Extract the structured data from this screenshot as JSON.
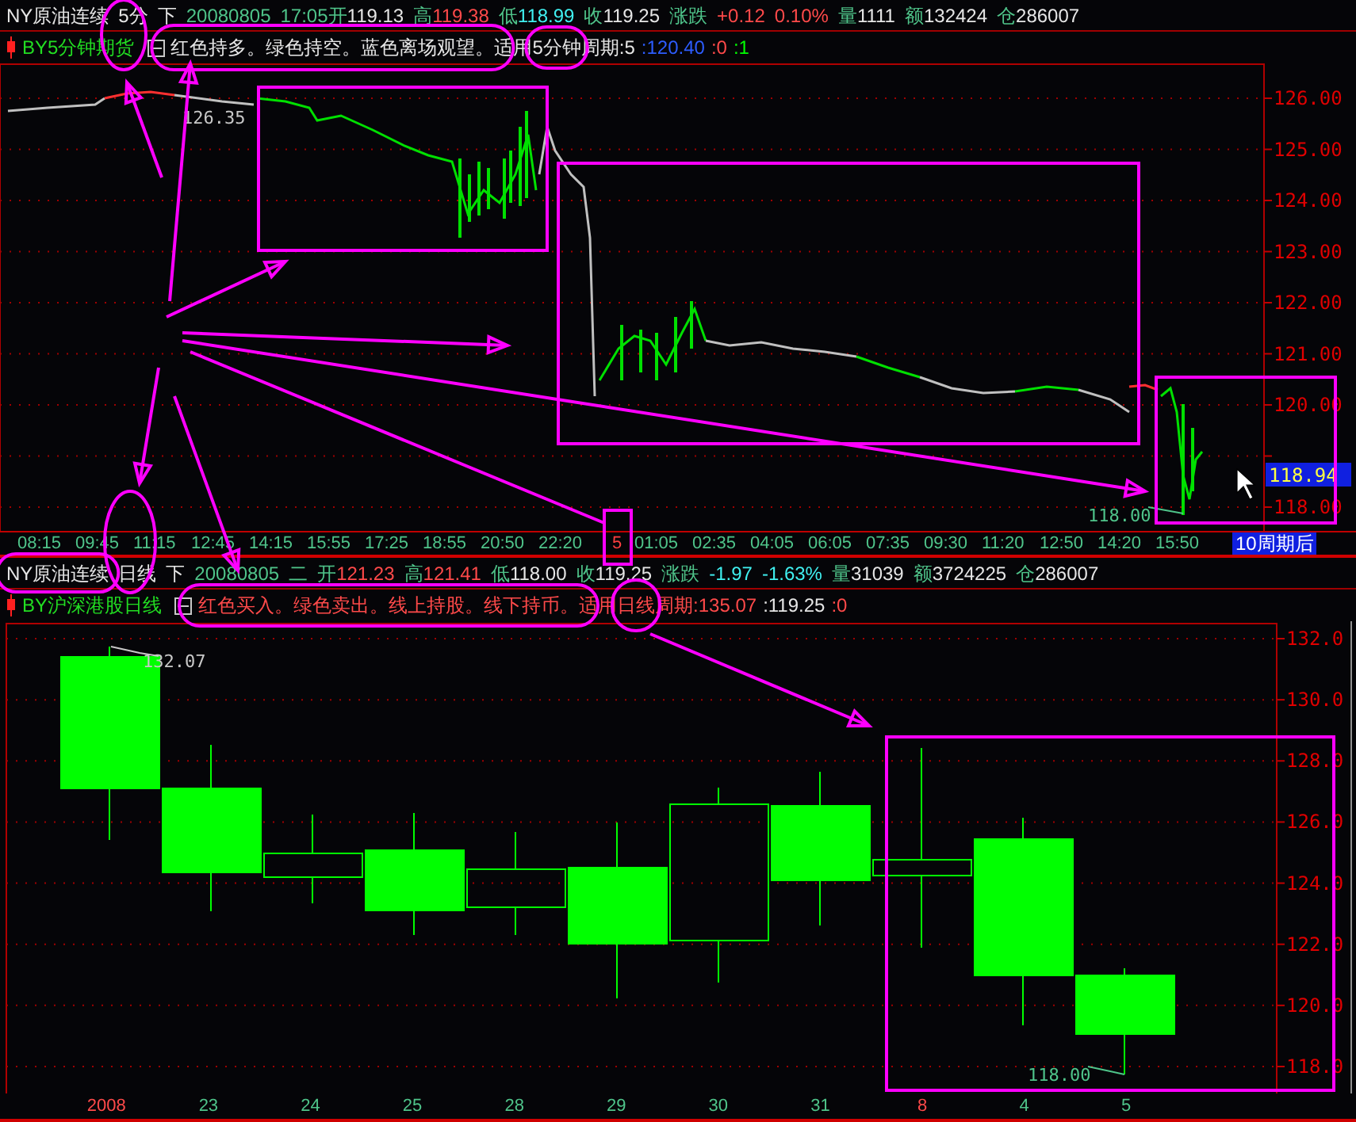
{
  "quote_header": [
    {
      "segments": [
        {
          "text": "NY原油连续",
          "kind": "white"
        }
      ]
    },
    {
      "segments": [
        {
          "text": "5分",
          "kind": "white"
        }
      ]
    },
    {
      "segments": [
        {
          "text": "下",
          "kind": "white"
        }
      ]
    },
    {
      "segments": [
        {
          "text": "20080805",
          "kind": "label"
        }
      ]
    },
    {
      "segments": [
        {
          "text": "17:05",
          "kind": "label"
        },
        {
          "text": "开",
          "kind": "label"
        },
        {
          "text": "119.13",
          "kind": "white"
        }
      ]
    },
    {
      "segments": [
        {
          "text": "高",
          "kind": "label"
        },
        {
          "text": "119.38",
          "kind": "red"
        }
      ]
    },
    {
      "segments": [
        {
          "text": "低",
          "kind": "label"
        },
        {
          "text": "118.99",
          "kind": "cyan"
        }
      ]
    },
    {
      "segments": [
        {
          "text": "收",
          "kind": "label"
        },
        {
          "text": "119.25",
          "kind": "white"
        }
      ]
    },
    {
      "segments": [
        {
          "text": "涨跌",
          "kind": "label"
        }
      ]
    },
    {
      "segments": [
        {
          "text": "+0.12",
          "kind": "red"
        }
      ]
    },
    {
      "segments": [
        {
          "text": "0.10%",
          "kind": "red"
        }
      ]
    },
    {
      "segments": [
        {
          "text": "量",
          "kind": "label"
        },
        {
          "text": "1111",
          "kind": "white"
        }
      ]
    },
    {
      "segments": [
        {
          "text": "额",
          "kind": "label"
        },
        {
          "text": "132424",
          "kind": "white"
        }
      ]
    },
    {
      "segments": [
        {
          "text": "仓",
          "kind": "label"
        },
        {
          "text": "286007",
          "kind": "white"
        }
      ]
    }
  ],
  "indicator": {
    "name": "BY5分钟期货",
    "segments": [
      {
        "text": "红色持多。绿色持空。蓝色离场观望。",
        "kind": "white"
      },
      {
        "text": "适用",
        "kind": "white"
      },
      {
        "text": "5分钟",
        "kind": "white"
      },
      {
        "text": "周期:5",
        "kind": "white"
      },
      {
        "text": ":120.40",
        "kind": "blue"
      },
      {
        "text": ":0",
        "kind": "red"
      },
      {
        "text": ":1",
        "kind": "green"
      }
    ]
  },
  "intraday_chart": {
    "price_labels": [
      "126.00",
      "125.00",
      "124.00",
      "123.00",
      "122.00",
      "121.00",
      "120.00",
      "118.00"
    ],
    "current_price": "118.94",
    "high_marker": "126.35",
    "low_marker": "118.00"
  },
  "time_axis": {
    "labels": [
      {
        "text": "08:15",
        "kind": "time"
      },
      {
        "text": "09:45",
        "kind": "time"
      },
      {
        "text": "11:15",
        "kind": "time"
      },
      {
        "text": "12:45",
        "kind": "time"
      },
      {
        "text": "14:15",
        "kind": "time"
      },
      {
        "text": "15:55",
        "kind": "time"
      },
      {
        "text": "17:25",
        "kind": "time"
      },
      {
        "text": "18:55",
        "kind": "time"
      },
      {
        "text": "20:50",
        "kind": "time"
      },
      {
        "text": "22:20",
        "kind": "time"
      },
      {
        "text": "5",
        "kind": "day"
      },
      {
        "text": "01:05",
        "kind": "time"
      },
      {
        "text": "02:35",
        "kind": "time"
      },
      {
        "text": "04:05",
        "kind": "time"
      },
      {
        "text": "06:05",
        "kind": "time"
      },
      {
        "text": "07:35",
        "kind": "time"
      },
      {
        "text": "09:30",
        "kind": "time"
      },
      {
        "text": "11:20",
        "kind": "time"
      },
      {
        "text": "12:50",
        "kind": "time"
      },
      {
        "text": "14:20",
        "kind": "time"
      },
      {
        "text": "15:50",
        "kind": "time"
      }
    ],
    "button": "10周期后"
  },
  "daily_header": [
    {
      "segments": [
        {
          "text": "NY原油连续",
          "kind": "white"
        }
      ]
    },
    {
      "segments": [
        {
          "text": "日线",
          "kind": "white"
        }
      ]
    },
    {
      "segments": [
        {
          "text": "下",
          "kind": "white"
        }
      ]
    },
    {
      "segments": [
        {
          "text": "20080805",
          "kind": "label"
        }
      ]
    },
    {
      "segments": [
        {
          "text": "二",
          "kind": "label"
        }
      ]
    },
    {
      "segments": [
        {
          "text": "开",
          "kind": "label"
        },
        {
          "text": "121.23",
          "kind": "red"
        }
      ]
    },
    {
      "segments": [
        {
          "text": "高",
          "kind": "label"
        },
        {
          "text": "121.41",
          "kind": "red"
        }
      ]
    },
    {
      "segments": [
        {
          "text": "低",
          "kind": "label"
        },
        {
          "text": "118.00",
          "kind": "white"
        }
      ]
    },
    {
      "segments": [
        {
          "text": "收",
          "kind": "label"
        },
        {
          "text": "119.25",
          "kind": "white"
        }
      ]
    },
    {
      "segments": [
        {
          "text": "涨跌",
          "kind": "label"
        }
      ]
    },
    {
      "segments": [
        {
          "text": "-1.97",
          "kind": "cyan"
        }
      ]
    },
    {
      "segments": [
        {
          "text": "-1.63%",
          "kind": "cyan"
        }
      ]
    },
    {
      "segments": [
        {
          "text": "量",
          "kind": "label"
        },
        {
          "text": "31039",
          "kind": "white"
        }
      ]
    },
    {
      "segments": [
        {
          "text": "额",
          "kind": "label"
        },
        {
          "text": "3724225",
          "kind": "white"
        }
      ]
    },
    {
      "segments": [
        {
          "text": "仓",
          "kind": "label"
        },
        {
          "text": "286007",
          "kind": "white"
        }
      ]
    }
  ],
  "daily_indicator": {
    "name": "BY沪深港股日线",
    "segments": [
      {
        "text": "红色买入。绿色卖出。线上持股。线下持币。",
        "kind": "red"
      },
      {
        "text": "适用",
        "kind": "red"
      },
      {
        "text": "日线",
        "kind": "red"
      },
      {
        "text": "周期:135.07",
        "kind": "red"
      },
      {
        "text": ":119.25",
        "kind": "white"
      },
      {
        "text": ":0",
        "kind": "red"
      }
    ]
  },
  "daily_chart": {
    "price_labels": [
      "132.0",
      "130.0",
      "128.0",
      "126.0",
      "124.0",
      "122.0",
      "120.0",
      "118.0"
    ],
    "high_marker": "132.07",
    "low_marker": "118.00"
  },
  "date_axis": [
    {
      "text": "2008",
      "kind": "period"
    },
    {
      "text": "23",
      "kind": "day"
    },
    {
      "text": "24",
      "kind": "day"
    },
    {
      "text": "25",
      "kind": "day"
    },
    {
      "text": "28",
      "kind": "day"
    },
    {
      "text": "29",
      "kind": "day"
    },
    {
      "text": "30",
      "kind": "day"
    },
    {
      "text": "31",
      "kind": "day"
    },
    {
      "text": "8",
      "kind": "period"
    },
    {
      "text": "4",
      "kind": "day"
    },
    {
      "text": "5",
      "kind": "day"
    }
  ]
}
